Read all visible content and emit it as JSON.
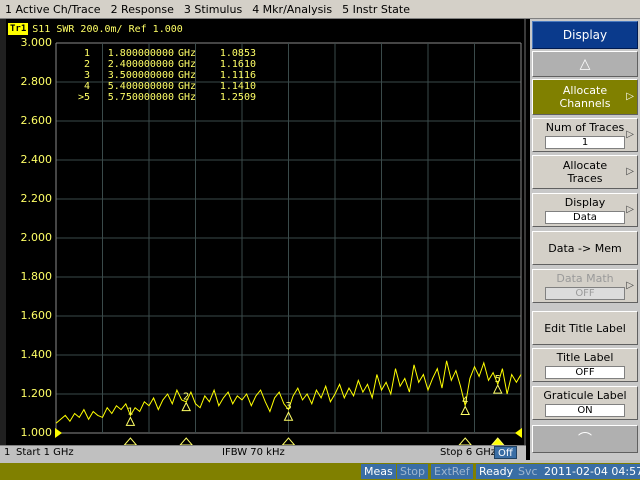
{
  "menu": [
    "1 Active Ch/Trace",
    "2 Response",
    "3 Stimulus",
    "4 Mkr/Analysis",
    "5 Instr State"
  ],
  "trace": {
    "badge": "Tr1",
    "header": "S11  SWR 200.0m/ Ref 1.000",
    "color": "#ffff00"
  },
  "markers": [
    {
      "id": "1",
      "freq": "1.800000000",
      "unit": "GHz",
      "value": "1.0853"
    },
    {
      "id": "2",
      "freq": "2.400000000",
      "unit": "GHz",
      "value": "1.1610"
    },
    {
      "id": "3",
      "freq": "3.500000000",
      "unit": "GHz",
      "value": "1.1116"
    },
    {
      "id": "4",
      "freq": "5.400000000",
      "unit": "GHz",
      "value": "1.1410"
    },
    {
      "id": ">5",
      "freq": "5.750000000",
      "unit": "GHz",
      "value": "1.2509"
    }
  ],
  "y_ticks": [
    "3.000",
    "2.800",
    "2.600",
    "2.400",
    "2.200",
    "2.000",
    "1.800",
    "1.600",
    "1.400",
    "1.200",
    "1.000"
  ],
  "chart_data": {
    "type": "line",
    "title": "S11  SWR 200.0m/ Ref 1.000",
    "xlabel": "",
    "ylabel": "",
    "xlim": [
      1.0,
      6.0
    ],
    "ylim": [
      1.0,
      3.0
    ],
    "grid": true,
    "series": [
      {
        "name": "S11",
        "x": [
          1.0,
          1.05,
          1.1,
          1.15,
          1.2,
          1.25,
          1.3,
          1.35,
          1.4,
          1.45,
          1.5,
          1.55,
          1.6,
          1.65,
          1.7,
          1.75,
          1.8,
          1.85,
          1.9,
          1.95,
          2.0,
          2.05,
          2.1,
          2.15,
          2.2,
          2.25,
          2.3,
          2.35,
          2.4,
          2.45,
          2.5,
          2.55,
          2.6,
          2.65,
          2.7,
          2.75,
          2.8,
          2.85,
          2.9,
          2.95,
          3.0,
          3.05,
          3.1,
          3.15,
          3.2,
          3.25,
          3.3,
          3.35,
          3.4,
          3.45,
          3.5,
          3.55,
          3.6,
          3.65,
          3.7,
          3.75,
          3.8,
          3.85,
          3.9,
          3.95,
          4.0,
          4.05,
          4.1,
          4.15,
          4.2,
          4.25,
          4.3,
          4.35,
          4.4,
          4.45,
          4.5,
          4.55,
          4.6,
          4.65,
          4.7,
          4.75,
          4.8,
          4.85,
          4.9,
          4.95,
          5.0,
          5.05,
          5.1,
          5.15,
          5.2,
          5.25,
          5.3,
          5.35,
          5.4,
          5.45,
          5.5,
          5.55,
          5.6,
          5.65,
          5.7,
          5.75,
          5.8,
          5.85,
          5.9,
          5.95,
          6.0
        ],
        "y": [
          1.05,
          1.07,
          1.09,
          1.06,
          1.1,
          1.08,
          1.12,
          1.07,
          1.11,
          1.09,
          1.08,
          1.13,
          1.1,
          1.14,
          1.12,
          1.15,
          1.09,
          1.13,
          1.11,
          1.16,
          1.14,
          1.18,
          1.12,
          1.17,
          1.2,
          1.15,
          1.22,
          1.17,
          1.16,
          1.21,
          1.15,
          1.13,
          1.19,
          1.16,
          1.22,
          1.14,
          1.18,
          1.21,
          1.15,
          1.19,
          1.17,
          1.2,
          1.14,
          1.19,
          1.22,
          1.16,
          1.11,
          1.18,
          1.21,
          1.15,
          1.12,
          1.19,
          1.23,
          1.17,
          1.2,
          1.15,
          1.22,
          1.18,
          1.24,
          1.16,
          1.2,
          1.25,
          1.18,
          1.23,
          1.19,
          1.27,
          1.21,
          1.25,
          1.18,
          1.3,
          1.22,
          1.26,
          1.2,
          1.33,
          1.24,
          1.28,
          1.21,
          1.35,
          1.26,
          1.3,
          1.22,
          1.28,
          1.33,
          1.23,
          1.37,
          1.27,
          1.32,
          1.24,
          1.14,
          1.28,
          1.34,
          1.29,
          1.36,
          1.27,
          1.31,
          1.25,
          1.33,
          1.2,
          1.3,
          1.26,
          1.3
        ]
      }
    ],
    "markers": [
      {
        "label": "1",
        "x": 1.8,
        "y": 1.0853
      },
      {
        "label": "2",
        "x": 2.4,
        "y": 1.161
      },
      {
        "label": "3",
        "x": 3.5,
        "y": 1.1116
      },
      {
        "label": "4",
        "x": 5.4,
        "y": 1.141
      },
      {
        "label": "5",
        "x": 5.75,
        "y": 1.2509
      }
    ]
  },
  "channel_status": {
    "index": "1",
    "start": "Start 1 GHz",
    "ifbw": "IFBW 70 kHz",
    "stop": "Stop 6 GHz",
    "off": "Off"
  },
  "softkeys": {
    "title": "Display",
    "allocate_channels": "Allocate Channels",
    "num_traces_label": "Num of Traces",
    "num_traces_value": "1",
    "allocate_traces": "Allocate Traces",
    "display_label": "Display",
    "display_value": "Data",
    "data_to_mem": "Data -> Mem",
    "data_math_label": "Data Math",
    "data_math_value": "OFF",
    "edit_title_label": "Edit Title Label",
    "title_label": "Title Label",
    "title_label_value": "OFF",
    "graticule_label": "Graticule Label",
    "graticule_value": "ON"
  },
  "status": {
    "meas": "Meas",
    "stop": "Stop",
    "extref": "ExtRef",
    "ready": "Ready",
    "svc": "Svc",
    "datetime": "2011-02-04 04:57"
  }
}
